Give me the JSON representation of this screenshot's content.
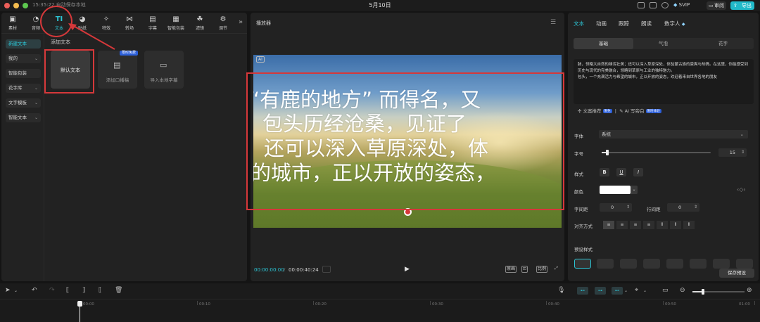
{
  "titlebar": {
    "autosave": "15:35:22 自动保存本地",
    "title": "5月10日",
    "svip": "SVIP",
    "review": "审阅",
    "export": "导出",
    "colors": {
      "accent": "#21b9c9",
      "close": "#ec5f5a",
      "minimize": "#f4bd4f",
      "maximize": "#5dc84f"
    }
  },
  "toolbar": {
    "items": [
      {
        "label": "素材",
        "icon": "media-icon"
      },
      {
        "label": "音频",
        "icon": "audio-icon"
      },
      {
        "label": "文本",
        "icon": "text-icon",
        "glyph": "TI"
      },
      {
        "label": "贴纸",
        "icon": "sticker-icon"
      },
      {
        "label": "特效",
        "icon": "effects-icon"
      },
      {
        "label": "转场",
        "icon": "transition-icon"
      },
      {
        "label": "字幕",
        "icon": "subtitle-icon"
      },
      {
        "label": "智能包装",
        "icon": "smart-pack-icon"
      },
      {
        "label": "滤镜",
        "icon": "filter-icon"
      },
      {
        "label": "调节",
        "icon": "adjust-icon"
      }
    ],
    "more": "»"
  },
  "sidenav": {
    "items": [
      {
        "label": "新建文本",
        "active": true
      },
      {
        "label": "我的",
        "chevron": true
      },
      {
        "label": "智能包装"
      },
      {
        "label": "花字库",
        "chevron": true
      },
      {
        "label": "文字模板",
        "chevron": true
      },
      {
        "label": "智能文本",
        "chevron": true
      }
    ]
  },
  "content": {
    "section_title": "添加文本",
    "cards": [
      {
        "label": "默认文本"
      },
      {
        "label": "添加口播稿",
        "badge": "限时免费"
      },
      {
        "label": "导入本地字幕"
      }
    ]
  },
  "player": {
    "title": "播放器",
    "ai_tag": "AI",
    "subtitle_lines": [
      "“有鹿的地方” 而得名，又",
      "，包头历经沧桑，见证了",
      "，还可以深入草原深处，体",
      "的城市，正以开放的姿态，"
    ],
    "time_current": "00:00:00:00",
    "time_sep": "/",
    "time_total": "00:00:40:24",
    "controls": [
      "原画",
      "⊡",
      "比例",
      "⤢"
    ]
  },
  "right": {
    "tabs": [
      "文本",
      "动画",
      "跟踪",
      "朗读",
      "数字人"
    ],
    "subtabs": [
      "基础",
      "气泡",
      "花字"
    ],
    "text_content": "脉，领略大自然的雄浑壮美；还可以深入草原深处，体验蒙古族的豪爽与热情。在这里，你能感受到历史与现代的完美融合，领略到草原与工业的独特魅力。\n包头，一个充满活力与希望的城市，正以开放的姿态，欢迎着来自世界各地的朋友",
    "assist_recommend": "文案推荐",
    "assist_recommend_badge": "限免",
    "assist_ai": "AI 写旁白",
    "assist_ai_badge": "限时体验",
    "font_label": "字体",
    "font_value": "系统",
    "size_label": "字号",
    "size_value": "15",
    "size_slider": 0.05,
    "style_label": "样式",
    "style_buttons": [
      "B",
      "U",
      "I"
    ],
    "color_label": "颜色",
    "color_value": "#ffffff",
    "letter_spacing_label": "字间距",
    "letter_spacing_value": "0",
    "line_spacing_label": "行间距",
    "line_spacing_value": "0",
    "align_label": "对齐方式",
    "align_buttons": [
      "≡",
      "≡",
      "≡",
      "≡",
      "⦀",
      "⦀",
      "⦀"
    ],
    "preset_label": "预设样式",
    "save_preset": "保存预设"
  },
  "timeline": {
    "ticks": [
      "00:00",
      "00:10",
      "00:20",
      "00:30",
      "00:40",
      "00:50",
      "01:00"
    ],
    "zoom": 0.2
  }
}
